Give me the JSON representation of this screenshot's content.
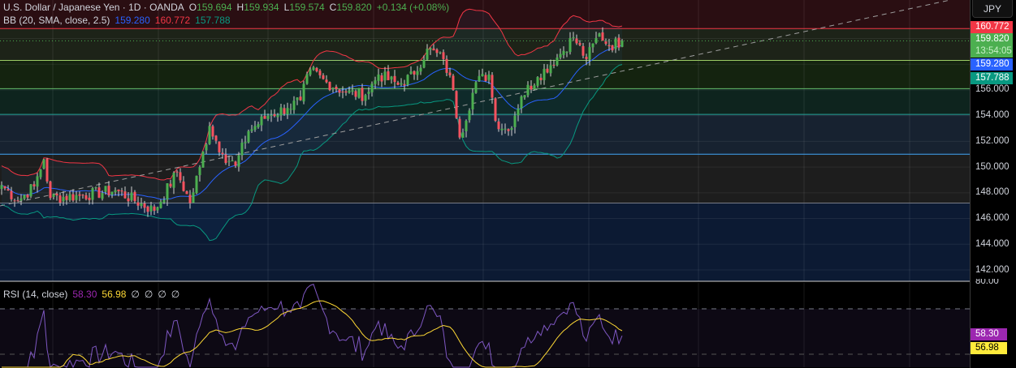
{
  "header": {
    "symbol": "U.S. Dollar / Japanese Yen · 1D · OANDA",
    "open_label": "O",
    "open": "159.694",
    "high_label": "H",
    "high": "159.934",
    "low_label": "L",
    "low": "159.574",
    "close_label": "C",
    "close": "159.820",
    "change": "+0.134 (+0.08%)"
  },
  "bb": {
    "label": "BB (20, SMA, close, 2.5)",
    "basis": "159.280",
    "upper": "160.772",
    "lower": "157.788"
  },
  "rsi": {
    "label": "RSI (14, close)",
    "value": "58.30",
    "ma": "56.98",
    "empty": [
      "∅",
      "∅",
      "∅",
      "∅"
    ]
  },
  "axis": {
    "currency": "JPY",
    "ticks": [
      "156.000",
      "154.000",
      "152.000",
      "150.000",
      "148.000",
      "146.000",
      "144.000",
      "142.000"
    ],
    "rsi_ticks": [
      "80.00"
    ],
    "tags": {
      "upper": "160.772",
      "last": "159.820",
      "countdown": "13:54:05",
      "basis": "159.280",
      "lower": "157.788",
      "rsi": "58.30",
      "rsi_ma": "56.98"
    }
  },
  "colors": {
    "up": "#4caf50",
    "down": "#f7525f",
    "basis": "#2962ff",
    "upper": "#f23645",
    "lower": "#089981",
    "rsi": "#7e57c2",
    "rsi_ma": "#fdd835"
  },
  "chart_data": {
    "type": "candlestick",
    "ylim": [
      141,
      162
    ],
    "rsi_ylim": [
      0,
      100
    ],
    "levels": [
      160.772,
      158.3,
      156.1,
      154.1,
      151.0,
      147.2
    ],
    "close_waypoints": [
      [
        0,
        148.6
      ],
      [
        5,
        147.4
      ],
      [
        10,
        148.5
      ],
      [
        13,
        150.6
      ],
      [
        15,
        147.6
      ],
      [
        25,
        147.8
      ],
      [
        35,
        148.2
      ],
      [
        47,
        146.6
      ],
      [
        54,
        149.6
      ],
      [
        58,
        147.2
      ],
      [
        61,
        150.0
      ],
      [
        64,
        153.2
      ],
      [
        68,
        151.0
      ],
      [
        72,
        150.1
      ],
      [
        76,
        152.8
      ],
      [
        82,
        154.0
      ],
      [
        88,
        154.6
      ],
      [
        92,
        155.2
      ],
      [
        95,
        157.6
      ],
      [
        100,
        156.6
      ],
      [
        106,
        155.8
      ],
      [
        112,
        155.6
      ],
      [
        116,
        157.2
      ],
      [
        122,
        156.4
      ],
      [
        127,
        157.2
      ],
      [
        131,
        159.2
      ],
      [
        136,
        158.4
      ],
      [
        139,
        156.0
      ],
      [
        141,
        152.3
      ],
      [
        146,
        156.6
      ],
      [
        150,
        157.2
      ],
      [
        152,
        153.6
      ],
      [
        156,
        152.8
      ],
      [
        160,
        155.5
      ],
      [
        165,
        157.0
      ],
      [
        172,
        158.8
      ],
      [
        176,
        160.1
      ],
      [
        180,
        158.4
      ],
      [
        184,
        160.4
      ],
      [
        187,
        159.4
      ],
      [
        191,
        159.82
      ]
    ]
  }
}
